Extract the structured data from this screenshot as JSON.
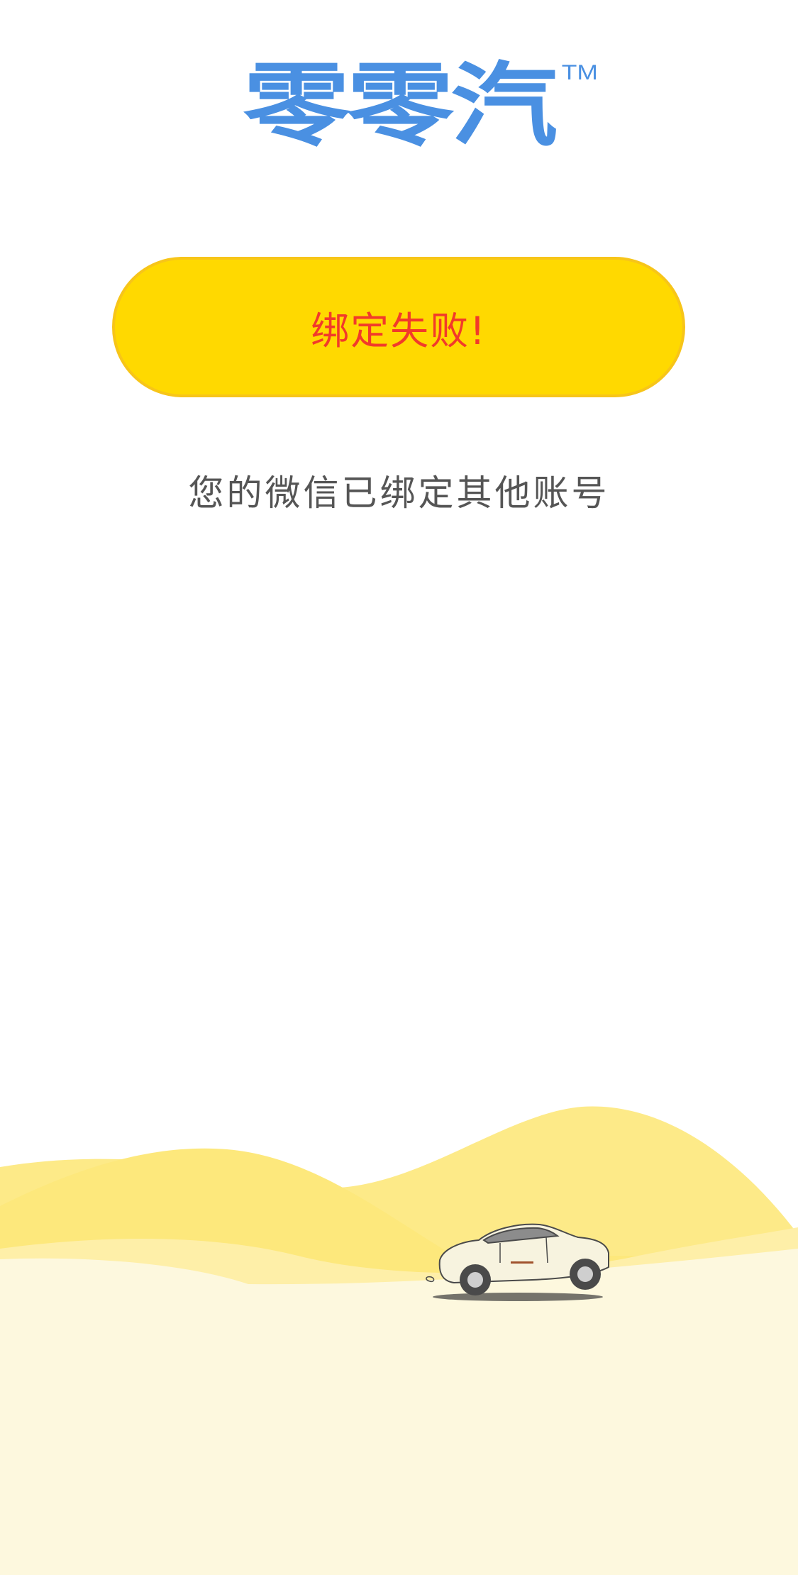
{
  "logo": {
    "text": "零零汽",
    "trademark": "TM",
    "color": "#4a90e2"
  },
  "status": {
    "label": "绑定失败!",
    "text_color": "#f23a2a",
    "background": "#ffd900"
  },
  "message": {
    "text": "您的微信已绑定其他账号",
    "color": "#555555"
  },
  "illustration": {
    "subject": "car-on-hills",
    "hill_colors": [
      "#fde97a",
      "#feefa0",
      "#fdf7dc"
    ]
  }
}
